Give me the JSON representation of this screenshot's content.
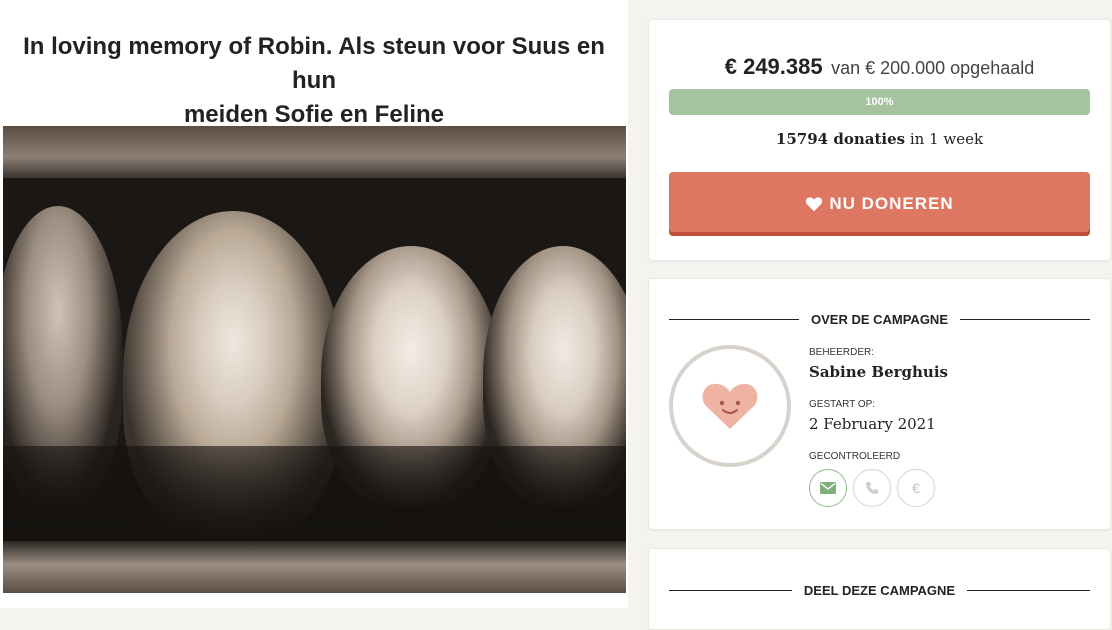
{
  "campaign": {
    "title_line1": "In loving memory of Robin. Als steun voor Suus en hun",
    "title_line2": "meiden Sofie en Feline"
  },
  "donation": {
    "raised": "€ 249.385",
    "goal_text": "van € 200.000 opgehaald",
    "progress_label": "100%",
    "progress_fraction": 1.0,
    "donations_count": "15794 donaties",
    "duration": "in 1 week",
    "donate_button": "NU DONEREN"
  },
  "about": {
    "heading": "OVER DE CAMPAGNE",
    "manager_label": "BEHEERDER:",
    "manager_name": "Sabine Berghuis",
    "started_label": "GESTART OP:",
    "started_date": "2 February 2021",
    "verified_label": "GECONTROLEERD",
    "verified_icons": [
      "envelope-icon",
      "phone-icon",
      "euro-icon"
    ]
  },
  "share": {
    "heading": "DEEL DEZE CAMPAGNE"
  },
  "colors": {
    "accent": "#dd7762",
    "progress": "#a6c3a0",
    "verified": "#7fb07a"
  }
}
